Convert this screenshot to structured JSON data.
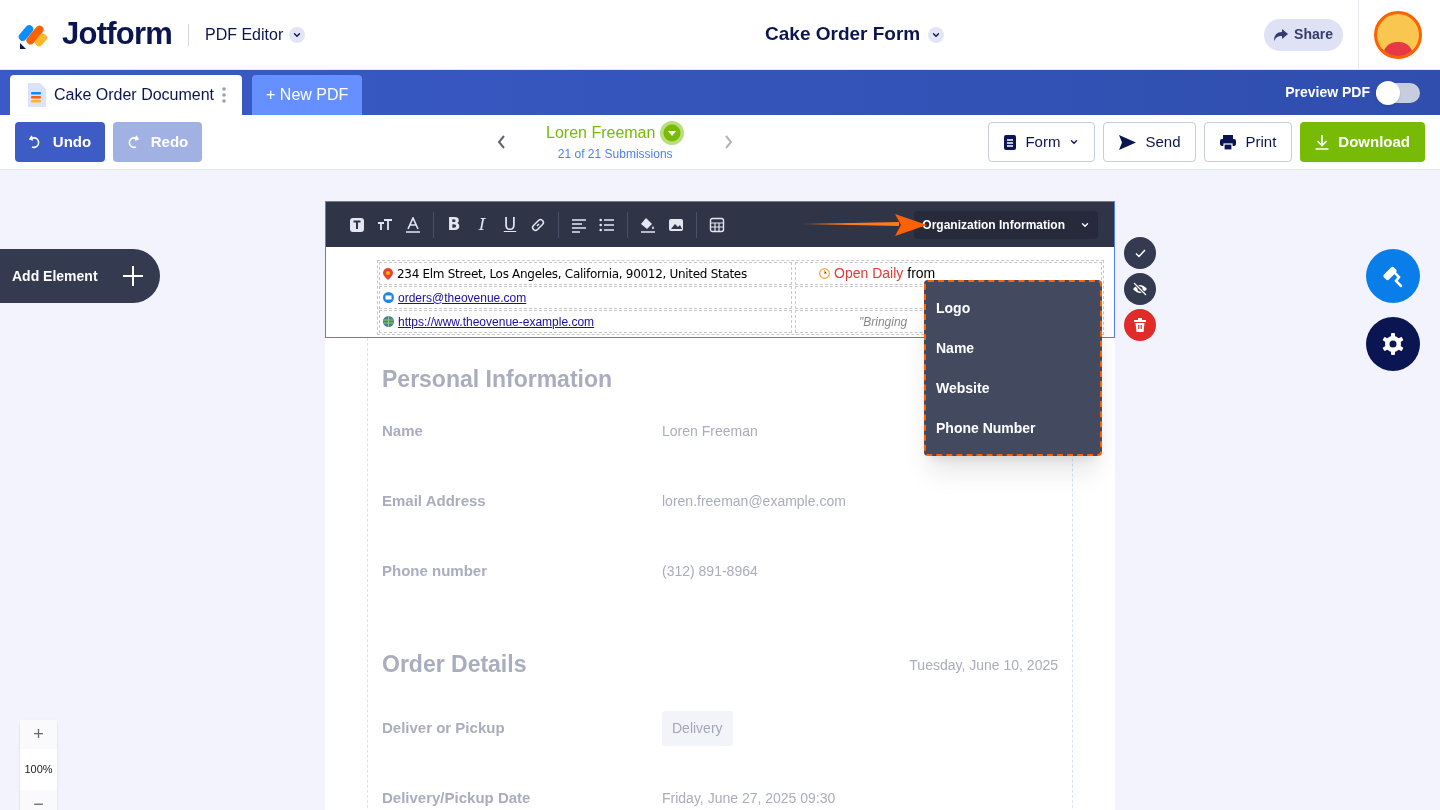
{
  "header": {
    "logo_text": "Jotform",
    "product": "PDF Editor",
    "form_title": "Cake Order Form",
    "share": "Share"
  },
  "tabs": [
    {
      "label": "Cake Order Document",
      "selected": true
    }
  ],
  "new_pdf": "+ New PDF",
  "preview_pdf": {
    "label": "Preview PDF",
    "on": false
  },
  "toolbar": {
    "undo": {
      "label": "Undo",
      "disabled": false
    },
    "redo": {
      "label": "Redo",
      "disabled": true
    },
    "submission_name": "Loren Freeman",
    "submission_count": "21 of 21 Submissions",
    "form": "Form",
    "send": "Send",
    "print": "Print",
    "download": "Download"
  },
  "add_element": "Add Element",
  "format_tools": [
    {
      "kind": "textbox"
    },
    {
      "kind": "textsize"
    },
    {
      "kind": "textcolor"
    },
    {
      "kind": "bold",
      "label": "B"
    },
    {
      "kind": "italic",
      "label": "I"
    },
    {
      "kind": "underline",
      "label": "U"
    },
    {
      "kind": "link"
    },
    {
      "kind": "align"
    },
    {
      "kind": "list"
    },
    {
      "kind": "fill"
    },
    {
      "kind": "image"
    },
    {
      "kind": "table"
    }
  ],
  "section_dropdown": {
    "label": "Organization Information",
    "menu": [
      {
        "label": "Logo"
      },
      {
        "label": "Name"
      },
      {
        "label": "Website"
      },
      {
        "label": "Phone Number"
      }
    ]
  },
  "org_rows": [
    {
      "kind": "address",
      "text": "234 Elm Street, Los Angeles, California, 90012, United States",
      "right_highlight": "Open Daily",
      "right_text": "from"
    },
    {
      "kind": "email",
      "text": "orders@theovenue.com"
    },
    {
      "kind": "website",
      "text": "https://www.theovenue-example.com",
      "right_quote": "\"Bringing"
    }
  ],
  "sections": [
    {
      "title": "Personal Information",
      "fields": [
        {
          "kind": "text",
          "label": "Name",
          "value": "Loren Freeman"
        },
        {
          "kind": "text",
          "label": "Email Address",
          "value": "loren.freeman@example.com"
        },
        {
          "kind": "text",
          "label": "Phone number",
          "value": "(312) 891-8964"
        }
      ]
    },
    {
      "title": "Order Details",
      "date": "Tuesday, June 10, 2025",
      "fields": [
        {
          "kind": "chip",
          "label": "Deliver or Pickup",
          "value": "Delivery"
        },
        {
          "kind": "text",
          "label": "Delivery/Pickup Date",
          "value": "Friday, June 27, 2025 09:30"
        }
      ]
    }
  ],
  "zoom": {
    "plus": "+",
    "level": "100%",
    "minus": "−"
  }
}
